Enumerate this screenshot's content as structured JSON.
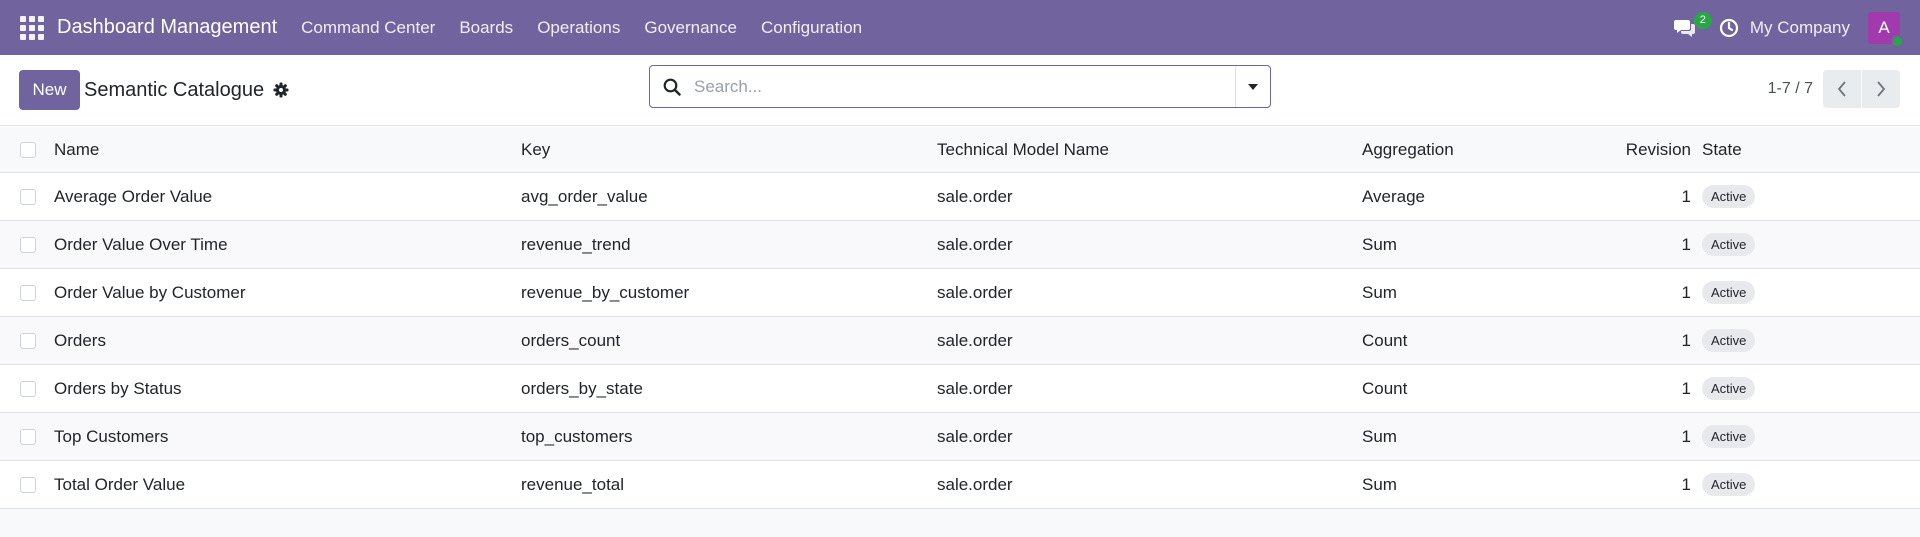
{
  "navbar": {
    "brand": "Dashboard Management",
    "menu": [
      "Command Center",
      "Boards",
      "Operations",
      "Governance",
      "Configuration"
    ],
    "chat_count": "2",
    "company": "My Company",
    "avatar_letter": "A",
    "colors": {
      "bar": "#71639e",
      "badge": "#28a745",
      "avatar": "#a03aad"
    },
    "icons": [
      "apps-grid-icon",
      "chat-icon",
      "clock-icon"
    ]
  },
  "control": {
    "new_label": "New",
    "title": "Semantic Catalogue",
    "search_placeholder": "Search...",
    "pager": "1-7 / 7"
  },
  "table": {
    "columns": {
      "name": "Name",
      "key": "Key",
      "model": "Technical Model Name",
      "aggregation": "Aggregation",
      "revision": "Revision",
      "state": "State"
    },
    "rows": [
      {
        "name": "Average Order Value",
        "key": "avg_order_value",
        "model": "sale.order",
        "aggregation": "Average",
        "revision": "1",
        "state": "Active"
      },
      {
        "name": "Order Value Over Time",
        "key": "revenue_trend",
        "model": "sale.order",
        "aggregation": "Sum",
        "revision": "1",
        "state": "Active"
      },
      {
        "name": "Order Value by Customer",
        "key": "revenue_by_customer",
        "model": "sale.order",
        "aggregation": "Sum",
        "revision": "1",
        "state": "Active"
      },
      {
        "name": "Orders",
        "key": "orders_count",
        "model": "sale.order",
        "aggregation": "Count",
        "revision": "1",
        "state": "Active"
      },
      {
        "name": "Orders by Status",
        "key": "orders_by_state",
        "model": "sale.order",
        "aggregation": "Count",
        "revision": "1",
        "state": "Active"
      },
      {
        "name": "Top Customers",
        "key": "top_customers",
        "model": "sale.order",
        "aggregation": "Sum",
        "revision": "1",
        "state": "Active"
      },
      {
        "name": "Total Order Value",
        "key": "revenue_total",
        "model": "sale.order",
        "aggregation": "Sum",
        "revision": "1",
        "state": "Active"
      }
    ]
  }
}
